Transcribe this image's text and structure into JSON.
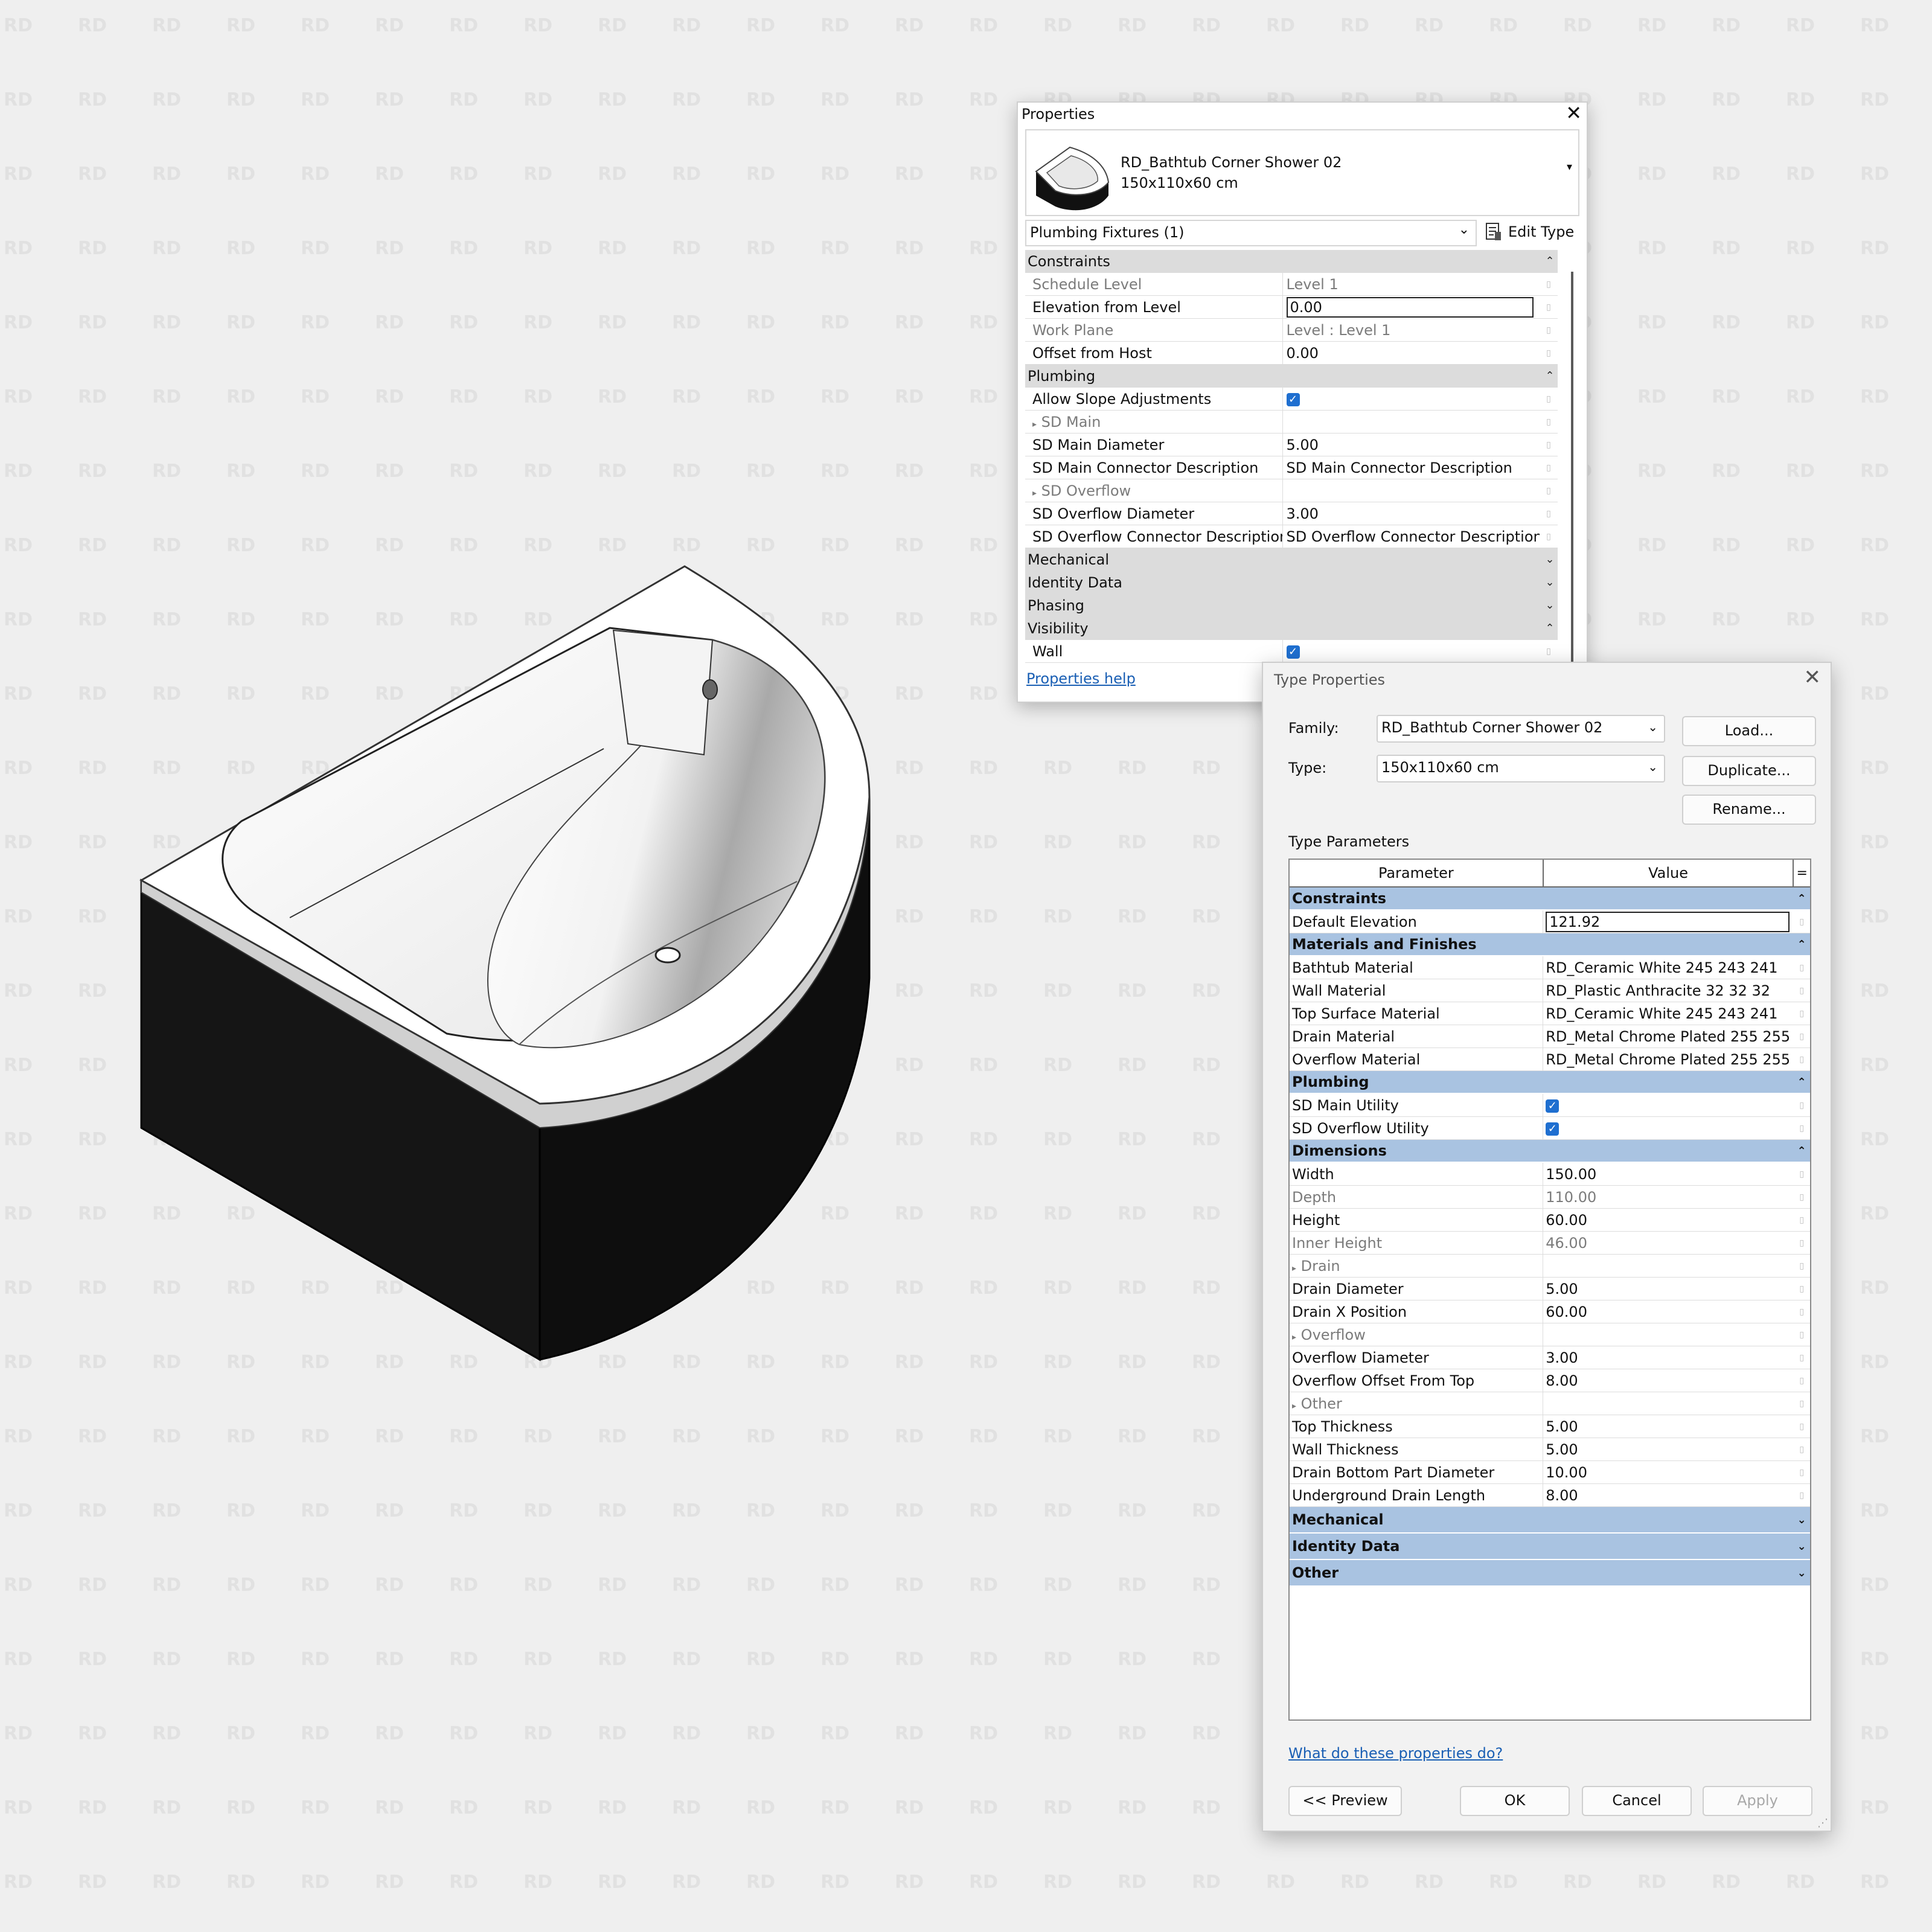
{
  "watermark": "RD",
  "properties": {
    "title": "Properties",
    "family_name": "RD_Bathtub Corner Shower 02",
    "type_name": "150x110x60 cm",
    "filter": "Plumbing Fixtures (1)",
    "edit_type": "Edit Type",
    "rows": [
      {
        "kind": "group",
        "label": "Constraints",
        "icon": "collapse"
      },
      {
        "label": "Schedule Level",
        "value": "Level 1",
        "readonly": true
      },
      {
        "label": "Elevation from Level",
        "value": "0.00",
        "active": true
      },
      {
        "label": "Work Plane",
        "value": "Level : Level 1",
        "readonly": true
      },
      {
        "label": "Offset from Host",
        "value": "0.00"
      },
      {
        "kind": "group",
        "label": "Plumbing",
        "icon": "collapse"
      },
      {
        "label": "Allow Slope Adjustments",
        "checked": true
      },
      {
        "kind": "sub",
        "label": "SD Main"
      },
      {
        "label": "SD Main Diameter",
        "value": "5.00"
      },
      {
        "label": "SD Main Connector Description",
        "value": "SD Main Connector Description"
      },
      {
        "kind": "sub",
        "label": "SD Overflow"
      },
      {
        "label": "SD Overflow Diameter",
        "value": "3.00"
      },
      {
        "label": "SD Overflow Connector Description",
        "value": "SD Overflow Connector Description"
      },
      {
        "kind": "group",
        "label": "Mechanical",
        "icon": "expand"
      },
      {
        "kind": "group",
        "label": "Identity Data",
        "icon": "expand"
      },
      {
        "kind": "group",
        "label": "Phasing",
        "icon": "expand"
      },
      {
        "kind": "group",
        "label": "Visibility",
        "icon": "collapse"
      },
      {
        "label": "Wall",
        "checked": true
      }
    ],
    "help_link": "Properties help"
  },
  "type_properties": {
    "title": "Type Properties",
    "family_label": "Family:",
    "family_value": "RD_Bathtub Corner Shower 02",
    "type_label": "Type:",
    "type_value": "150x110x60 cm",
    "load_button": "Load...",
    "duplicate_button": "Duplicate...",
    "rename_button": "Rename...",
    "type_parameters_label": "Type Parameters",
    "col_parameter": "Parameter",
    "col_value": "Value",
    "col_extra": "=",
    "rows": [
      {
        "kind": "group",
        "label": "Constraints",
        "icon": "collapse"
      },
      {
        "label": "Default Elevation",
        "value": "121.92",
        "active": true
      },
      {
        "kind": "group",
        "label": "Materials and Finishes",
        "icon": "collapse"
      },
      {
        "label": "Bathtub Material",
        "value": "RD_Ceramic White 245 243 241"
      },
      {
        "label": "Wall Material",
        "value": "RD_Plastic Anthracite 32 32 32"
      },
      {
        "label": "Top Surface Material",
        "value": "RD_Ceramic White 245 243 241"
      },
      {
        "label": "Drain Material",
        "value": "RD_Metal Chrome Plated 255 255"
      },
      {
        "label": "Overflow Material",
        "value": "RD_Metal Chrome Plated 255 255"
      },
      {
        "kind": "group",
        "label": "Plumbing",
        "icon": "collapse"
      },
      {
        "label": "SD Main Utility",
        "checked": true
      },
      {
        "label": "SD Overflow Utility",
        "checked": true
      },
      {
        "kind": "group",
        "label": "Dimensions",
        "icon": "collapse"
      },
      {
        "label": "Width",
        "value": "150.00"
      },
      {
        "label": "Depth",
        "value": "110.00",
        "readonly": true
      },
      {
        "label": "Height",
        "value": "60.00"
      },
      {
        "label": "Inner Height",
        "value": "46.00",
        "readonly": true
      },
      {
        "kind": "sub",
        "label": "Drain"
      },
      {
        "label": "Drain Diameter",
        "value": "5.00"
      },
      {
        "label": "Drain X Position",
        "value": "60.00"
      },
      {
        "kind": "sub",
        "label": "Overflow"
      },
      {
        "label": "Overflow Diameter",
        "value": "3.00"
      },
      {
        "label": "Overflow Offset From Top",
        "value": "8.00"
      },
      {
        "kind": "sub",
        "label": "Other"
      },
      {
        "label": "Top Thickness",
        "value": "5.00"
      },
      {
        "label": "Wall Thickness",
        "value": "5.00"
      },
      {
        "label": "Drain Bottom Part Diameter",
        "value": "10.00"
      },
      {
        "label": "Underground Drain Length",
        "value": "8.00"
      },
      {
        "kind": "group",
        "label": "Mechanical",
        "icon": "expand",
        "collapsed": true
      },
      {
        "kind": "group",
        "label": "Identity Data",
        "icon": "expand",
        "collapsed": true
      },
      {
        "kind": "group",
        "label": "Other",
        "icon": "expand",
        "collapsed": true
      }
    ],
    "what_link": "What do these properties do?",
    "preview_button": "<< Preview",
    "ok_button": "OK",
    "cancel_button": "Cancel",
    "apply_button": "Apply"
  },
  "colors": {
    "background": "#efefef",
    "group_header_blue": "#a9c3e1",
    "checkbox_blue": "#1f6fd0",
    "link_blue": "#1a5fb4",
    "tub_black": "#101010"
  },
  "icons": {
    "close": "close-icon",
    "dropdown": "chevron-down-icon",
    "collapse": "double-chevron-up-icon",
    "expand": "double-chevron-down-icon",
    "edit_type": "edit-type-icon"
  }
}
